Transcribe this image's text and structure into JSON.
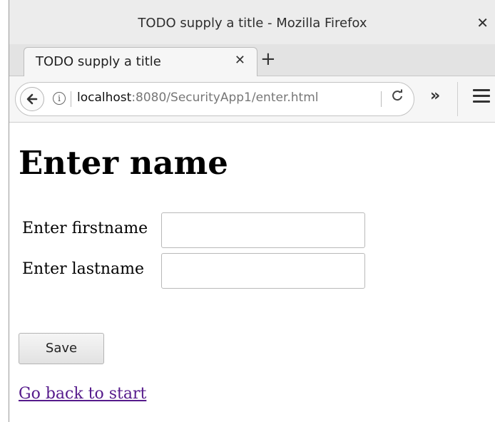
{
  "window": {
    "title": "TODO supply a title - Mozilla Firefox",
    "close_icon": "close-icon"
  },
  "tabs": [
    {
      "label": "TODO supply a title",
      "close_icon": "close-icon"
    }
  ],
  "new_tab_icon": "plus-icon",
  "navbar": {
    "back_icon": "back-arrow-icon",
    "info_icon": "info-icon",
    "url_host": "localhost",
    "url_rest": ":8080/SecurityApp1/enter.html",
    "reload_icon": "reload-icon",
    "overflow_icon": "overflow-chevron-icon",
    "menu_icon": "hamburger-menu-icon"
  },
  "page": {
    "heading": "Enter name",
    "firstname_label": "Enter firstname",
    "firstname_value": "",
    "lastname_label": "Enter lastname",
    "lastname_value": "",
    "save_label": "Save",
    "back_link": "Go back to start",
    "link_color": "#551a8b"
  }
}
